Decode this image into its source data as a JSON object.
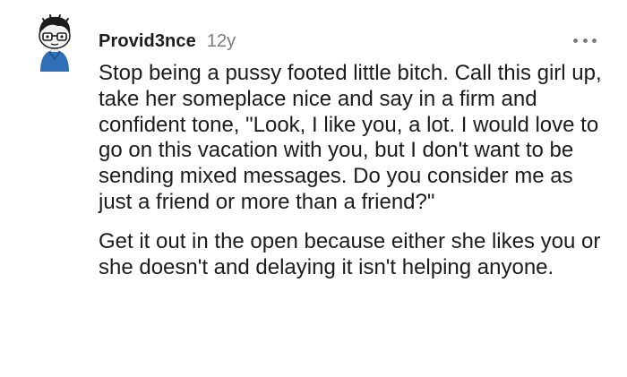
{
  "comment": {
    "author": "Provid3nce",
    "age": "12y",
    "avatar_icon": "snoo-avatar-with-glasses-icon",
    "more_icon": "more-options-icon",
    "paragraphs": [
      "Stop being a pussy footed little bitch. Call this girl up, take her someplace nice and say in a firm and confident tone, \"Look, I like you, a lot. I would love to go on this vacation with you, but I don't want to be sending mixed messages. Do you consider me as just a friend or more than a friend?\"",
      "Get it out in the open because either she likes you or she doesn't and delaying it isn't helping anyone."
    ]
  },
  "colors": {
    "text": "#1c1c1c",
    "meta": "#7c7c7c",
    "avatar_shirt": "#2f6fb8",
    "background": "#ffffff"
  }
}
